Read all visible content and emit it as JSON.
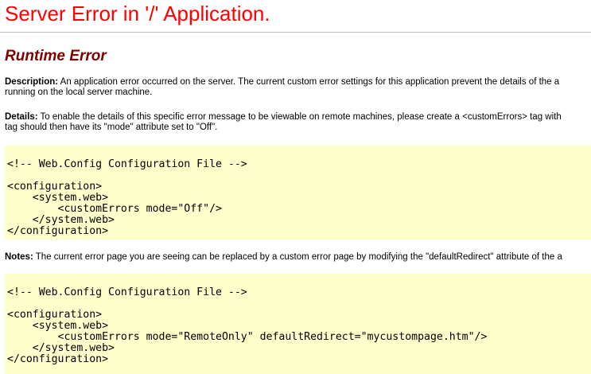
{
  "page": {
    "title": "Server Error in '/' Application.",
    "subtitle": "Runtime Error"
  },
  "description": {
    "label": "Description:",
    "line1": " An application error occurred on the server. The current custom error settings for this application prevent the details of the a",
    "line2": "running on the local server machine."
  },
  "details": {
    "label": "Details:",
    "line1": " To enable the details of this specific error message to be viewable on remote machines, please create a <customErrors> tag with",
    "line2": "tag should then have its \"mode\" attribute set to \"Off\"."
  },
  "code1": {
    "comment": "<!-- Web.Config Configuration File -->",
    "lines": [
      "<configuration>",
      "    <system.web>",
      "        <customErrors mode=\"Off\"/>",
      "    </system.web>",
      "</configuration>"
    ]
  },
  "notes": {
    "label": "Notes:",
    "line1": " The current error page you are seeing can be replaced by a custom error page by modifying the \"defaultRedirect\" attribute of the a"
  },
  "code2": {
    "comment": "<!-- Web.Config Configuration File -->",
    "lines": [
      "<configuration>",
      "    <system.web>",
      "        <customErrors mode=\"RemoteOnly\" defaultRedirect=\"mycustompage.htm\"/>",
      "    </system.web>",
      "</configuration>"
    ]
  },
  "colors": {
    "title": "#ff0000",
    "subtitle": "#800000",
    "code_background": "#ffffcc"
  }
}
